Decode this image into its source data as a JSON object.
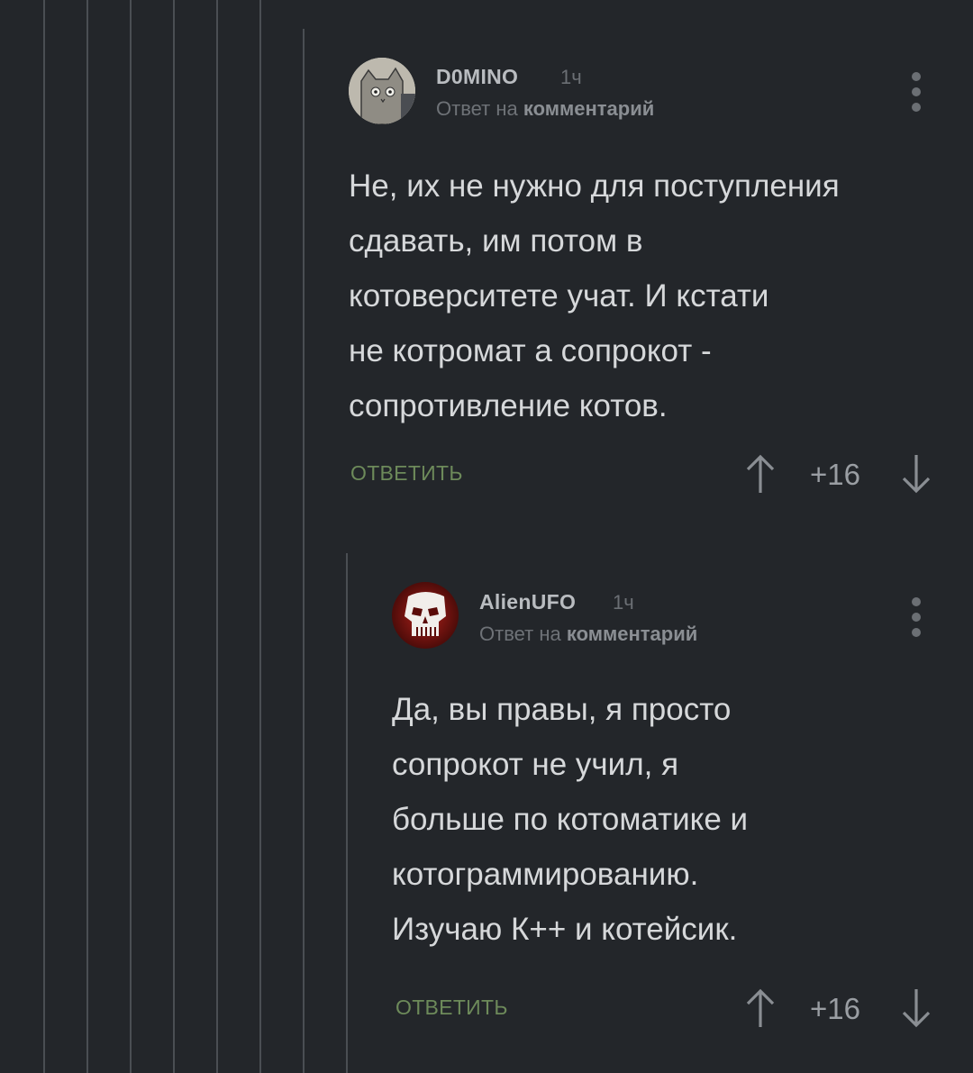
{
  "comments": [
    {
      "username": "D0MINO",
      "time": "1ч",
      "reply_prefix": "Ответ на",
      "reply_target": "комментарий",
      "body_lines": [
        "Не, их не нужно для поступления",
        "сдавать, им потом в",
        "котоверситете учат. И кстати",
        "не котромат а сопрокот -",
        "сопротивление котов."
      ],
      "reply_label": "ОТВЕТИТЬ",
      "rating": "+16"
    },
    {
      "username": "AlienUFO",
      "time": "1ч",
      "reply_prefix": "Ответ на",
      "reply_target": "комментарий",
      "body_lines": [
        "Да, вы правы, я просто",
        "сопрокот не учил, я",
        "больше по котоматике и",
        "котограммированию.",
        "Изучаю К++ и котейсик."
      ],
      "reply_label": "ОТВЕТИТЬ",
      "rating": "+16"
    }
  ],
  "colors": {
    "background": "#23262a",
    "thread_line": "#4a4e53",
    "reply_button": "#6d8a5a",
    "body_text": "#d6d8da"
  }
}
